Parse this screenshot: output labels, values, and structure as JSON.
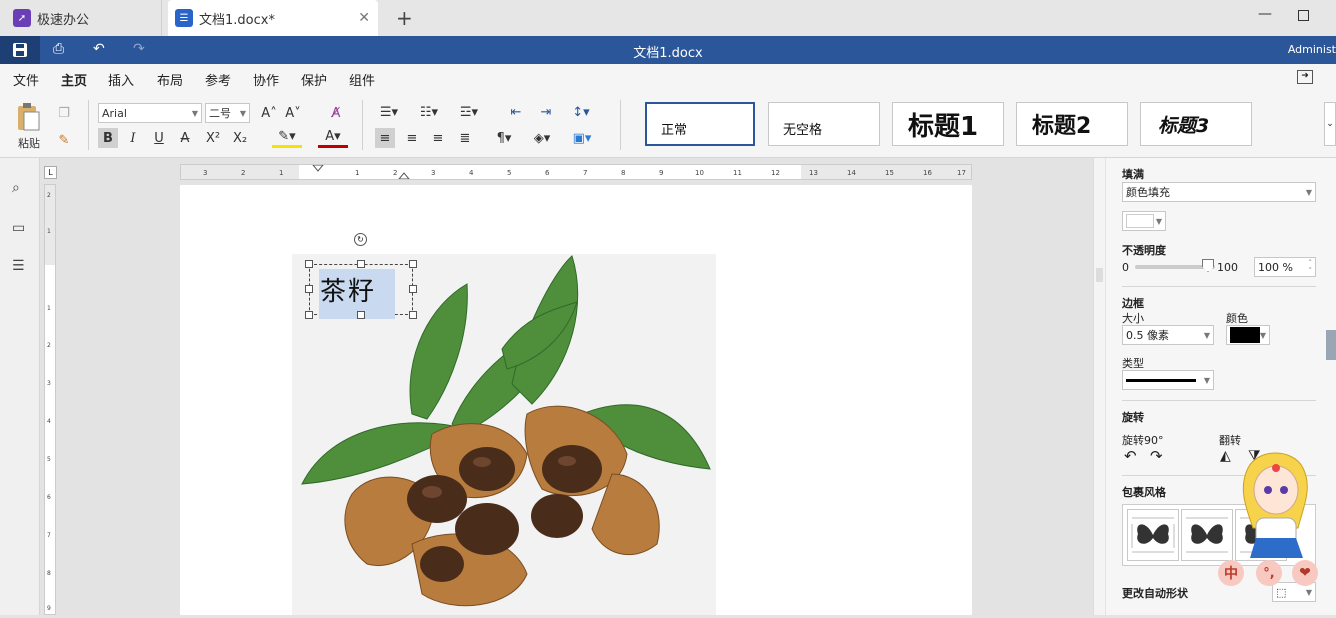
{
  "tabs": [
    {
      "label": "极速办公"
    },
    {
      "label": "文档1.docx*"
    }
  ],
  "window": {
    "title": "文档1.docx",
    "user": "Administ"
  },
  "menu": [
    "文件",
    "主页",
    "插入",
    "布局",
    "参考",
    "协作",
    "保护",
    "组件"
  ],
  "ribbon": {
    "paste_label": "粘贴",
    "font_name": "Arial",
    "font_size": "二号"
  },
  "styles": [
    "正常",
    "无空格",
    "标题1",
    "标题2",
    "标题3"
  ],
  "document": {
    "textbox_text": "茶籽"
  },
  "panel": {
    "fill_heading": "填满",
    "fill_type": "颜色填充",
    "opacity_heading": "不透明度",
    "opacity_min": "0",
    "opacity_max": "100",
    "opacity_value": "100 %",
    "opacity_level": 100,
    "border_heading": "边框",
    "border_size_label": "大小",
    "border_color_label": "颜色",
    "border_size": "0.5 像素",
    "border_type_label": "类型",
    "rotate_heading": "旋转",
    "rotate90_label": "旋转90°",
    "flip_label": "翻转",
    "wrap_heading": "包裹风格",
    "autoshape_label": "更改自动形状"
  },
  "mascot_badges": [
    "中",
    "°,",
    "❤"
  ],
  "colors": {
    "accent": "#2b579a",
    "border_color": "#000000",
    "fill_color": "#ffffff"
  }
}
